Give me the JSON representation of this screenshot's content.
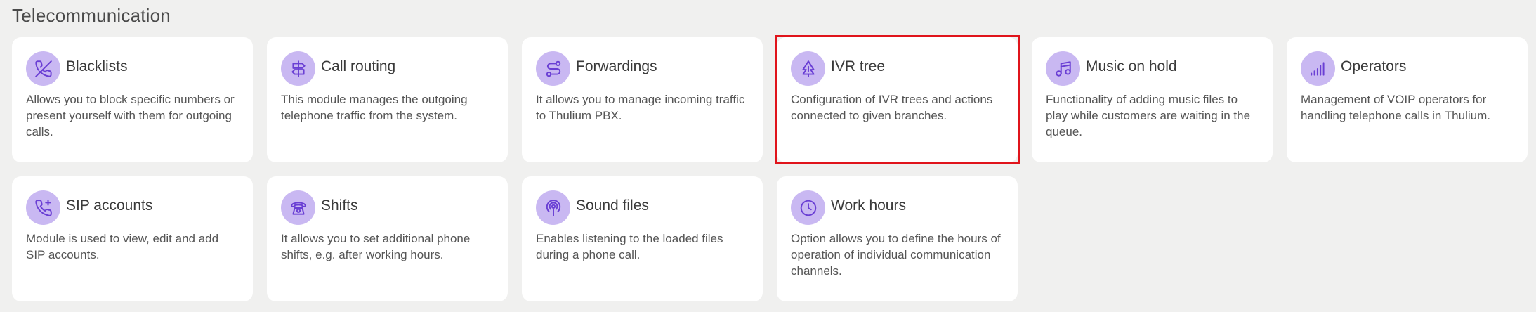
{
  "section": {
    "title": "Telecommunication"
  },
  "modules": [
    {
      "title": "Blacklists",
      "description": "Allows you to block specific numbers or present yourself with them for outgoing calls.",
      "icon": "phone-off-icon"
    },
    {
      "title": "Call routing",
      "description": "This module manages the outgoing telephone traffic from the system.",
      "icon": "signpost-icon"
    },
    {
      "title": "Forwardings",
      "description": "It allows you to manage incoming traffic to Thulium PBX.",
      "icon": "route-icon"
    },
    {
      "title": "IVR tree",
      "description": "Configuration of IVR trees and actions connected to given branches.",
      "icon": "tree-icon",
      "highlighted": true
    },
    {
      "title": "Music on hold",
      "description": "Functionality of adding music files to play while customers are waiting in the queue.",
      "icon": "music-note-icon"
    },
    {
      "title": "Operators",
      "description": "Management of VOIP operators for handling telephone calls in Thulium.",
      "icon": "signal-bars-icon"
    },
    {
      "title": "SIP accounts",
      "description": "Module is used to view, edit and add SIP accounts.",
      "icon": "phone-plus-icon"
    },
    {
      "title": "Shifts",
      "description": "It allows you to set additional phone shifts, e.g. after working hours.",
      "icon": "rotary-phone-icon"
    },
    {
      "title": "Sound files",
      "description": "Enables listening to the loaded files during a phone call.",
      "icon": "podcast-icon"
    },
    {
      "title": "Work hours",
      "description": "Option allows you to define the hours of operation of individual communication channels.",
      "icon": "clock-icon"
    }
  ],
  "colors": {
    "accent": "#6a3fd4",
    "icon_bg": "#c9b8f2",
    "highlight_border": "#e0141b",
    "page_bg": "#f0f0ef"
  }
}
